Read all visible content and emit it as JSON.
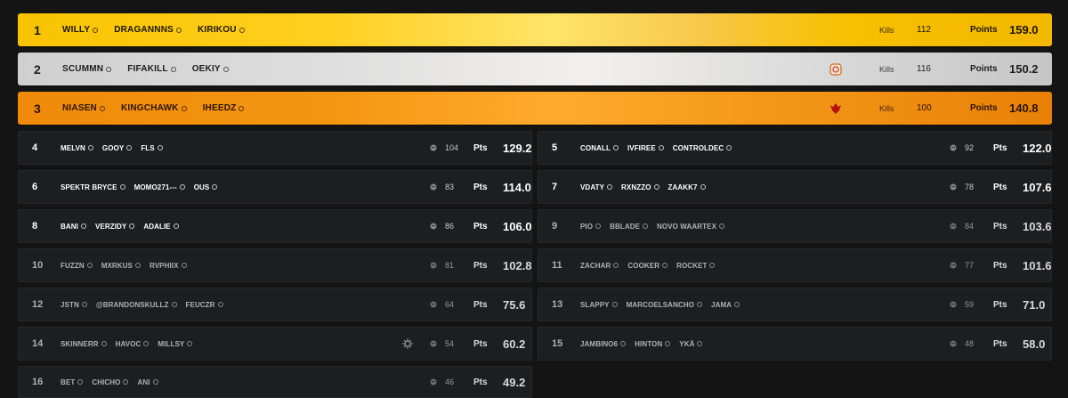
{
  "top": [
    {
      "rank": "1",
      "players": [
        "WILLY",
        "DRAGANNNS",
        "KIRIKOU"
      ],
      "kills_label": "Kills",
      "kills": "112",
      "points_label": "Points",
      "points": "159.0"
    },
    {
      "rank": "2",
      "players": [
        "SCUMMN",
        "FIFAKILL",
        "OEKIY"
      ],
      "kills_label": "Kills",
      "kills": "116",
      "points_label": "Points",
      "points": "150.2"
    },
    {
      "rank": "3",
      "players": [
        "NIASEN",
        "KINGCHAWK",
        "IHEEDZ"
      ],
      "kills_label": "Kills",
      "kills": "100",
      "points_label": "Points",
      "points": "140.8"
    }
  ],
  "rows": [
    {
      "rank": "4",
      "players": [
        "MELVN",
        "GOOY",
        "FLS"
      ],
      "kills": "104",
      "pts_label": "Pts",
      "points": "129.2"
    },
    {
      "rank": "5",
      "players": [
        "CONALL",
        "IVFIREE",
        "CONTROLDEC"
      ],
      "kills": "92",
      "pts_label": "Pts",
      "points": "122.0"
    },
    {
      "rank": "6",
      "players": [
        "SPEKTR BRYCE",
        "MOMO271---",
        "OUS"
      ],
      "kills": "83",
      "pts_label": "Pts",
      "points": "114.0"
    },
    {
      "rank": "7",
      "players": [
        "VDATY",
        "RXNZZO",
        "ZAAKK7"
      ],
      "kills": "78",
      "pts_label": "Pts",
      "points": "107.6"
    },
    {
      "rank": "8",
      "players": [
        "BANI",
        "VERZIDY",
        "ADALIE"
      ],
      "kills": "86",
      "pts_label": "Pts",
      "points": "106.0"
    },
    {
      "rank": "9",
      "players": [
        "PIO",
        "BBLADE",
        "NOVO WAARTEX"
      ],
      "kills": "84",
      "pts_label": "Pts",
      "points": "103.6"
    },
    {
      "rank": "10",
      "players": [
        "FUZZN",
        "MXRKUS",
        "RVPHIIX"
      ],
      "kills": "81",
      "pts_label": "Pts",
      "points": "102.8"
    },
    {
      "rank": "11",
      "players": [
        "ZACHAR",
        "COOKER",
        "ROCKET"
      ],
      "kills": "77",
      "pts_label": "Pts",
      "points": "101.6"
    },
    {
      "rank": "12",
      "players": [
        "JSTN",
        "@BRANDONSKULLZ",
        "FEUCZR"
      ],
      "kills": "64",
      "pts_label": "Pts",
      "points": "75.6"
    },
    {
      "rank": "13",
      "players": [
        "SLAPPY",
        "MARCOELSANCHO",
        "JAMA"
      ],
      "kills": "59",
      "pts_label": "Pts",
      "points": "71.0"
    },
    {
      "rank": "14",
      "players": [
        "SKINNERR",
        "HAVOC",
        "MILLSY"
      ],
      "kills": "54",
      "pts_label": "Pts",
      "points": "60.2"
    },
    {
      "rank": "15",
      "players": [
        "JAMBINO6",
        "HINTON",
        "YKÄ"
      ],
      "kills": "48",
      "pts_label": "Pts",
      "points": "58.0"
    },
    {
      "rank": "16",
      "players": [
        "BET",
        "CHICHO",
        "ANI"
      ],
      "kills": "46",
      "pts_label": "Pts",
      "points": "49.2"
    }
  ],
  "colors": {
    "gold": "#f8c300",
    "silver": "#d9d9d9",
    "bronze": "#f39012",
    "row_bg": "#1c1f22",
    "page_bg": "#141414"
  }
}
